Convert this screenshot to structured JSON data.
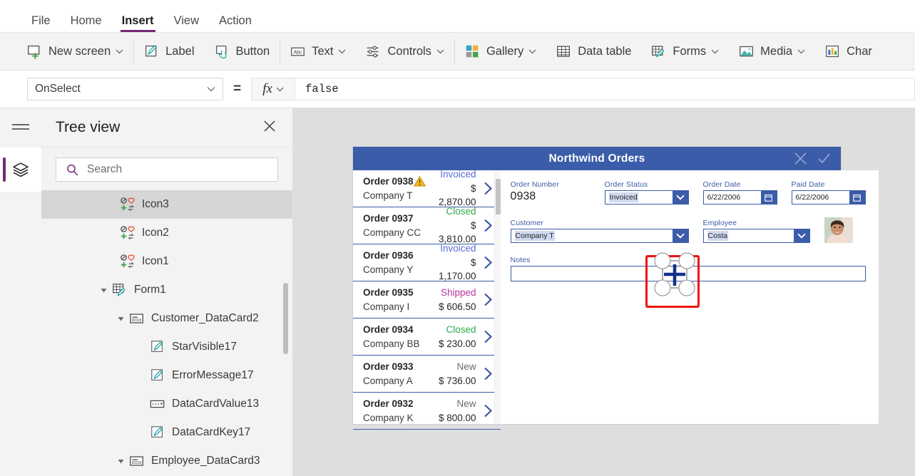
{
  "menu": {
    "tabs": [
      {
        "label": "File",
        "active": false
      },
      {
        "label": "Home",
        "active": false
      },
      {
        "label": "Insert",
        "active": true
      },
      {
        "label": "View",
        "active": false
      },
      {
        "label": "Action",
        "active": false
      }
    ]
  },
  "ribbon": {
    "items": [
      {
        "label": "New screen",
        "icon": "new-screen-icon",
        "caret": true
      },
      {
        "sep": true
      },
      {
        "label": "Label",
        "icon": "label-icon",
        "caret": false
      },
      {
        "label": "Button",
        "icon": "button-icon",
        "caret": false
      },
      {
        "sep": true
      },
      {
        "label": "Text",
        "icon": "text-icon",
        "caret": true
      },
      {
        "label": "Controls",
        "icon": "controls-icon",
        "caret": true
      },
      {
        "sep": true
      },
      {
        "label": "Gallery",
        "icon": "gallery-icon",
        "caret": true
      },
      {
        "label": "Data table",
        "icon": "data-table-icon",
        "caret": false
      },
      {
        "label": "Forms",
        "icon": "forms-icon",
        "caret": true
      },
      {
        "label": "Media",
        "icon": "media-icon",
        "caret": true
      },
      {
        "label": "Char",
        "icon": "charts-icon",
        "caret": false
      }
    ]
  },
  "formula_bar": {
    "property": "OnSelect",
    "equals": "=",
    "fx_label": "fx",
    "formula": "false"
  },
  "rail": {
    "hamburger": "hamburger-icon",
    "layers": "layers-icon"
  },
  "tree": {
    "title": "Tree view",
    "close": "close-icon",
    "search_placeholder": "Search",
    "search_value": "",
    "nodes": [
      {
        "label": "Icon3",
        "indent": 1,
        "icon": "icon-control",
        "twist": "",
        "selected": true
      },
      {
        "label": "Icon2",
        "indent": 1,
        "icon": "icon-control",
        "twist": "",
        "selected": false
      },
      {
        "label": "Icon1",
        "indent": 1,
        "icon": "icon-control",
        "twist": "",
        "selected": false
      },
      {
        "label": "Form1",
        "indent": 1,
        "icon": "form-control",
        "twist": "expanded",
        "selected": false
      },
      {
        "label": "Customer_DataCard2",
        "indent": 2,
        "icon": "datacard-control",
        "twist": "expanded",
        "selected": false
      },
      {
        "label": "StarVisible17",
        "indent": 3,
        "icon": "label-control",
        "twist": "",
        "selected": false
      },
      {
        "label": "ErrorMessage17",
        "indent": 3,
        "icon": "label-control",
        "twist": "",
        "selected": false
      },
      {
        "label": "DataCardValue13",
        "indent": 3,
        "icon": "dropdown-control",
        "twist": "",
        "selected": false
      },
      {
        "label": "DataCardKey17",
        "indent": 3,
        "icon": "label-control",
        "twist": "",
        "selected": false
      },
      {
        "label": "Employee_DataCard3",
        "indent": 2,
        "icon": "datacard-control",
        "twist": "expanded",
        "selected": false
      }
    ]
  },
  "app": {
    "title": "Northwind Orders",
    "header_bg": "#3b5ca8",
    "header_actions": [
      {
        "name": "cancel-icon"
      },
      {
        "name": "confirm-icon"
      }
    ],
    "gallery": [
      {
        "order": "Order 0938",
        "company": "Company T",
        "status": "Invoiced",
        "status_color": "#5b6cd6",
        "amount": "$ 2,870.00",
        "warning": true
      },
      {
        "order": "Order 0937",
        "company": "Company CC",
        "status": "Closed",
        "status_color": "#2eaa4a",
        "amount": "$ 3,810.00",
        "warning": false
      },
      {
        "order": "Order 0936",
        "company": "Company Y",
        "status": "Invoiced",
        "status_color": "#5b6cd6",
        "amount": "$ 1,170.00",
        "warning": false
      },
      {
        "order": "Order 0935",
        "company": "Company I",
        "status": "Shipped",
        "status_color": "#b5379b",
        "amount": "$ 606.50",
        "warning": false
      },
      {
        "order": "Order 0934",
        "company": "Company BB",
        "status": "Closed",
        "status_color": "#2eaa4a",
        "amount": "$ 230.00",
        "warning": false
      },
      {
        "order": "Order 0933",
        "company": "Company A",
        "status": "New",
        "status_color": "#6b6b6b",
        "amount": "$ 736.00",
        "warning": false
      },
      {
        "order": "Order 0932",
        "company": "Company K",
        "status": "New",
        "status_color": "#6b6b6b",
        "amount": "$ 800.00",
        "warning": false
      }
    ],
    "detail": {
      "order_number_label": "Order Number",
      "order_number_value": "0938",
      "order_status_label": "Order Status",
      "order_status_value": "Invoiced",
      "order_date_label": "Order Date",
      "order_date_value": "6/22/2006",
      "paid_date_label": "Paid Date",
      "paid_date_value": "6/22/2006",
      "customer_label": "Customer",
      "customer_value": "Company T",
      "employee_label": "Employee",
      "employee_value": "Costa",
      "notes_label": "Notes",
      "notes_value": ""
    }
  }
}
